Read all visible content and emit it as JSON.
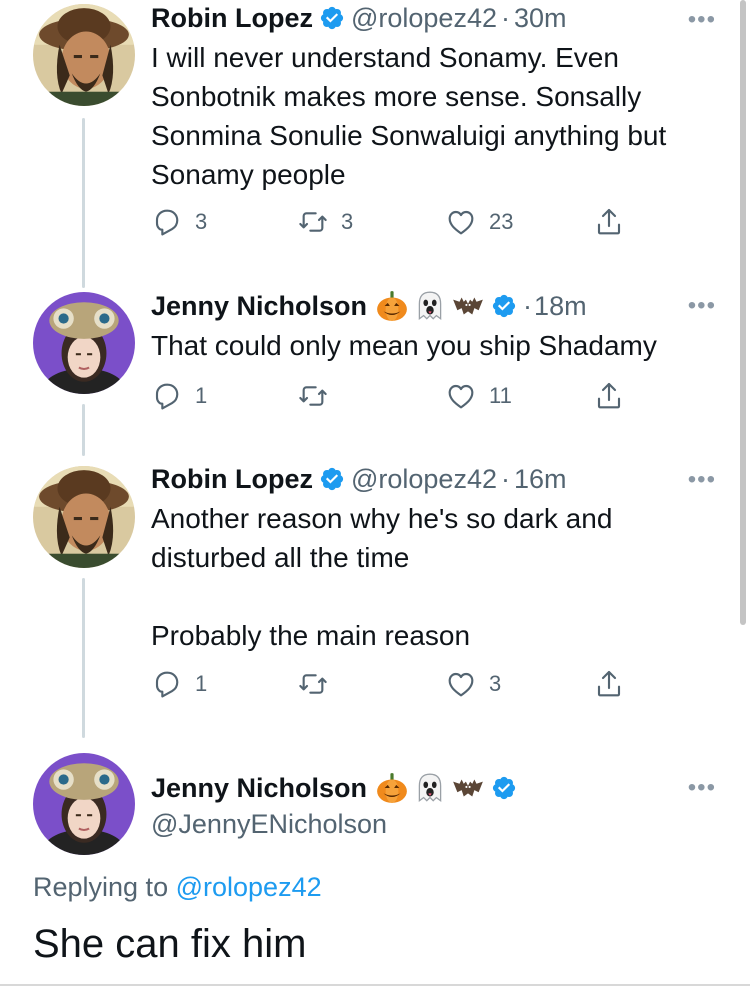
{
  "tweets": [
    {
      "author_name": "Robin Lopez",
      "verified": true,
      "handle": "@rolopez42",
      "separator": "·",
      "time": "30m",
      "text": "I will never understand Sonamy. Even Sonbotnik makes more sense. Sonsally Sonmina Sonulie Sonwaluigi anything but Sonamy people",
      "replies": "3",
      "retweets": "3",
      "likes": "23"
    },
    {
      "author_name": "Jenny Nicholson",
      "name_emojis": [
        "pumpkin",
        "ghost",
        "bat"
      ],
      "verified": true,
      "separator": "·",
      "time": "18m",
      "text": "That could only mean you ship Shadamy",
      "replies": "1",
      "retweets": "",
      "likes": "11"
    },
    {
      "author_name": "Robin Lopez",
      "verified": true,
      "handle": "@rolopez42",
      "separator": "·",
      "time": "16m",
      "text_line1": "Another reason why he's so dark and disturbed all the time",
      "text_line2": "Probably the main reason",
      "replies": "1",
      "retweets": "",
      "likes": "3"
    }
  ],
  "main_tweet": {
    "author_name": "Jenny Nicholson",
    "name_emojis": [
      "pumpkin",
      "ghost",
      "bat"
    ],
    "verified": true,
    "handle": "@JennyENicholson",
    "replying_to_label": "Replying to",
    "replying_to_handle": "@rolopez42",
    "text": "She can fix him"
  },
  "icons": {
    "more": "more-horizontal-icon",
    "reply": "reply-icon",
    "retweet": "retweet-icon",
    "like": "heart-icon",
    "share": "share-icon",
    "verified": "verified-badge-icon"
  },
  "colors": {
    "text": "#0f1419",
    "secondary": "#536471",
    "verified": "#1d9bf0",
    "link": "#1d9bf0",
    "thread_line": "#cfd9de"
  },
  "more_glyph": "•••"
}
